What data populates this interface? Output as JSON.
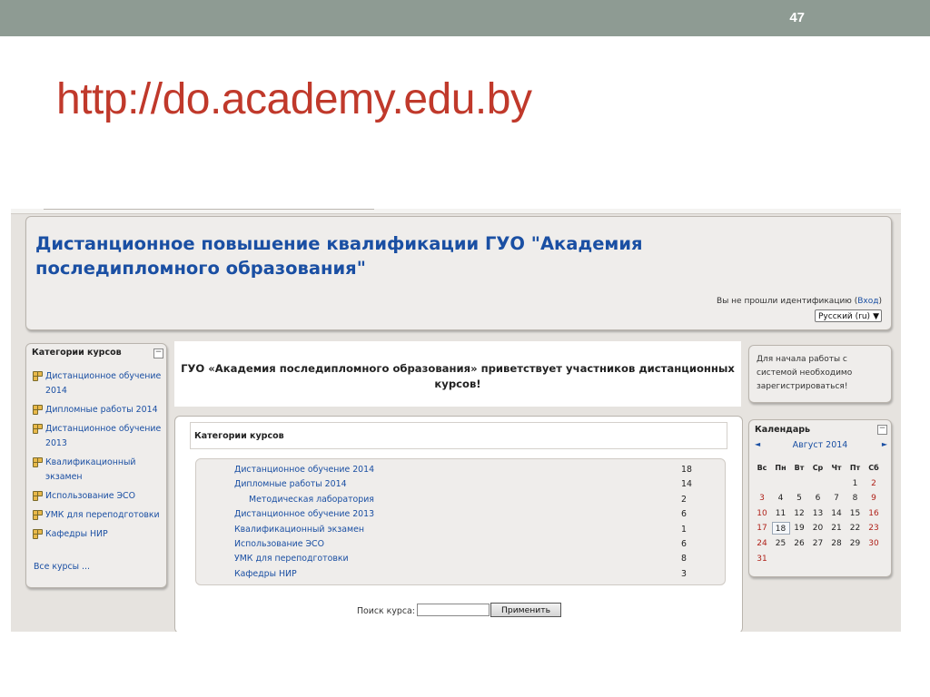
{
  "slide": {
    "number": "47",
    "title": "http://do.academy.edu.by"
  },
  "site": {
    "name": "Дистанционное повышение квалификации ГУО \"Академия последипломного образования\"",
    "login_text": "Вы не прошли идентификацию (",
    "login_link": "Вход",
    "login_close": ")",
    "language": "Русский (ru)"
  },
  "left_block": {
    "title": "Категории курсов",
    "items": [
      {
        "label": "Дистанционное обучение 2014"
      },
      {
        "label": "Дипломные работы 2014"
      },
      {
        "label": "Дистанционное обучение 2013"
      },
      {
        "label": "Квалификационный экзамен"
      },
      {
        "label": "Использование ЭСО"
      },
      {
        "label": "УМК для переподготовки"
      },
      {
        "label": "Кафедры НИР"
      }
    ],
    "all_courses": "Все курсы ..."
  },
  "welcome": {
    "text": "ГУО «Академия последипломного образования» приветствует участников дистанционных курсов!"
  },
  "main": {
    "title": "Категории курсов",
    "categories": [
      {
        "name": "Дистанционное обучение 2014",
        "count": "18",
        "sub": false
      },
      {
        "name": "Дипломные работы 2014",
        "count": "14",
        "sub": false
      },
      {
        "name": "Методическая лаборатория",
        "count": "2",
        "sub": true
      },
      {
        "name": "Дистанционное обучение 2013",
        "count": "6",
        "sub": false
      },
      {
        "name": "Квалификационный экзамен",
        "count": "1",
        "sub": false
      },
      {
        "name": "Использование ЭСО",
        "count": "6",
        "sub": false
      },
      {
        "name": "УМК для переподготовки",
        "count": "8",
        "sub": false
      },
      {
        "name": "Кафедры НИР",
        "count": "3",
        "sub": false
      }
    ],
    "search_label": "Поиск курса:",
    "search_value": "",
    "search_button": "Применить"
  },
  "note": {
    "text": "Для начала работы с системой необходимо зарегистрироваться!"
  },
  "calendar": {
    "title": "Календарь",
    "prev": "◄",
    "month": "Август 2014",
    "next": "►",
    "weekdays": [
      "Вс",
      "Пн",
      "Вт",
      "Ср",
      "Чт",
      "Пт",
      "Сб"
    ],
    "first_weekday_index": 5,
    "days_in_month": 31,
    "today": 18,
    "colors": {
      "weekend": "#b0221a",
      "link": "#1a4fa3"
    }
  }
}
